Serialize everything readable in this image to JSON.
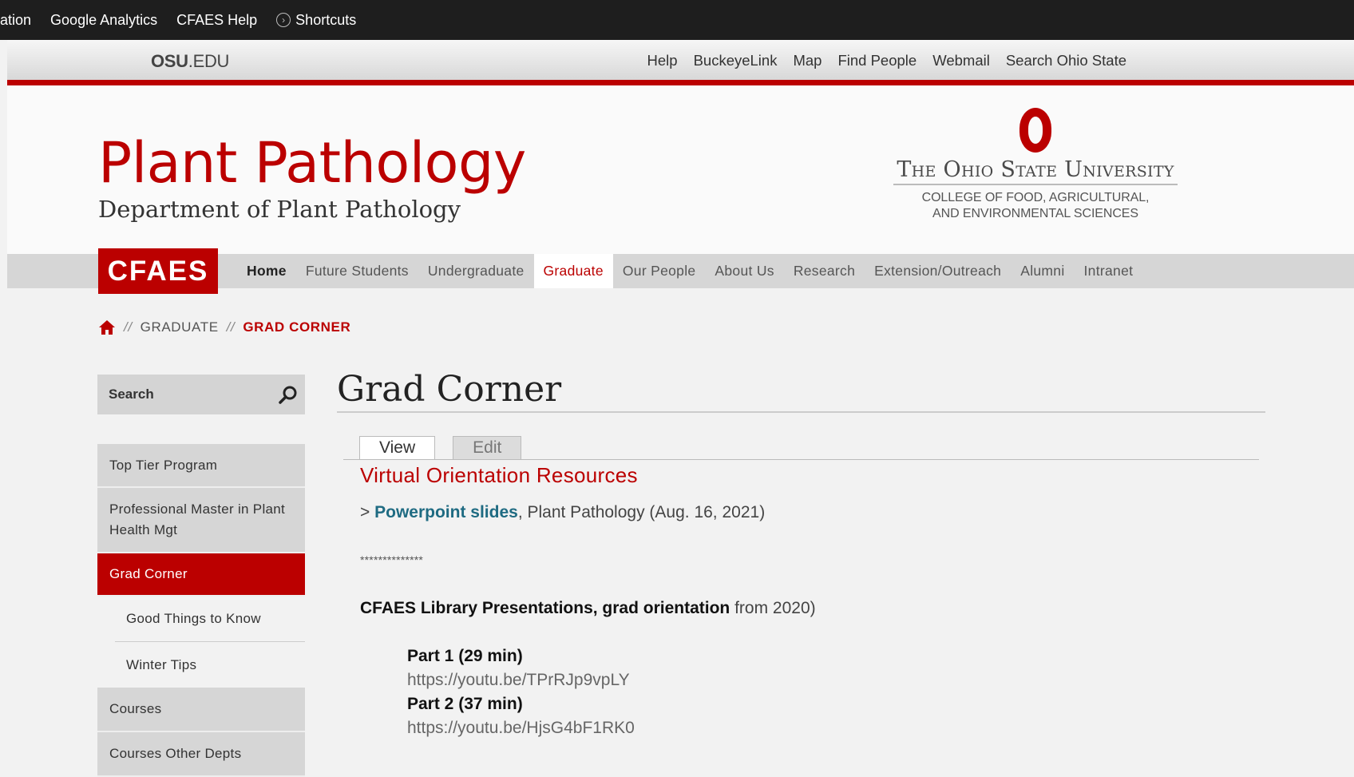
{
  "admin_bar": {
    "items": [
      "ation",
      "Google Analytics",
      "CFAES Help",
      "Shortcuts"
    ]
  },
  "osu_bar": {
    "logo_bold": "OSU",
    "logo_rest": ".EDU",
    "links": [
      "Help",
      "BuckeyeLink",
      "Map",
      "Find People",
      "Webmail",
      "Search Ohio State"
    ]
  },
  "header": {
    "title": "Plant Pathology",
    "subtitle": "Department of Plant Pathology",
    "university": "The Ohio State University",
    "college_line1": "College of Food, Agricultural,",
    "college_line2": "and Environmental Sciences"
  },
  "nav": {
    "logo": "CFAES",
    "items": [
      "Home",
      "Future Students",
      "Undergraduate",
      "Graduate",
      "Our People",
      "About Us",
      "Research",
      "Extension/Outreach",
      "Alumni",
      "Intranet"
    ],
    "active": "Graduate"
  },
  "breadcrumb": {
    "sep": "//",
    "items": [
      "GRADUATE",
      "GRAD CORNER"
    ]
  },
  "sidebar": {
    "search_placeholder": "Search",
    "items": [
      "Top Tier Program",
      "Professional Master in Plant Health Mgt",
      "Grad Corner",
      "Good Things to Know",
      "Winter Tips",
      "Courses",
      "Courses Other Depts"
    ]
  },
  "main": {
    "title": "Grad Corner",
    "tabs": [
      "View",
      "Edit"
    ],
    "heading": "Virtual Orientation Resources",
    "pp_prefix": "> ",
    "pp_link": "Powerpoint slides",
    "pp_suffix": ", Plant Pathology (Aug. 16, 2021)",
    "stars": "**************",
    "lib_bold": "CFAES Library Presentations, grad orientation",
    "lib_rest": " from 2020)",
    "parts": [
      {
        "label": "Part 1 (29 min)",
        "url": "https://youtu.be/TPrRJp9vpLY"
      },
      {
        "label": "Part 2 (37 min)",
        "url": "https://youtu.be/HjsG4bF1RK0"
      }
    ]
  },
  "colors": {
    "scarlet": "#bb0000",
    "link_teal": "#1f6b82"
  }
}
